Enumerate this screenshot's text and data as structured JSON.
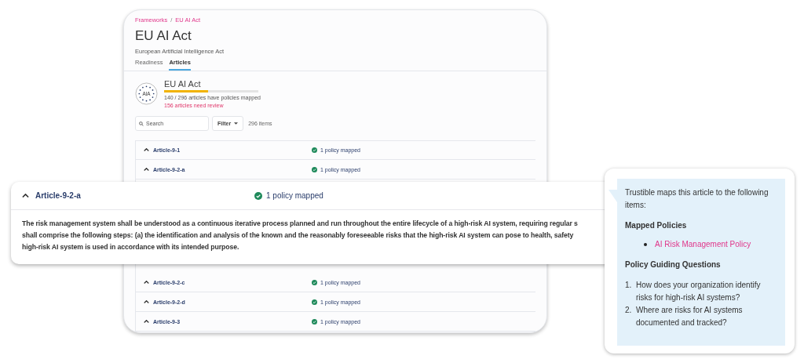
{
  "page": {
    "breadcrumb": [
      "Frameworks",
      "EU AI Act"
    ],
    "breadcrumb_separator": "/",
    "title": "EU AI Act",
    "subtitle": "European Artificial Intelligence Act",
    "tabs": [
      {
        "label": "Readiness",
        "selected": false
      },
      {
        "label": "Articles",
        "selected": true
      }
    ],
    "summary": {
      "logo_text": "AIA",
      "name": "EU AI Act",
      "level": 0.47,
      "mapped": "140 / 296 articles have policies mapped",
      "review": "156 articles need review"
    },
    "search": {
      "placeholder": "Search"
    },
    "filter": {
      "label": "Filter"
    },
    "count": "296 items",
    "rows_top": [
      {
        "name": "Article-9-1",
        "status": "1 policy mapped"
      },
      {
        "name": "Article-9-2-a",
        "status": "1 policy mapped"
      }
    ],
    "rows_bottom": [
      {
        "name": "Article-9-2-c",
        "status": "1 policy mapped"
      },
      {
        "name": "Article-9-2-d",
        "status": "1 policy mapped"
      },
      {
        "name": "Article-9-3",
        "status": "1 policy mapped"
      }
    ]
  },
  "expanded_row": {
    "name": "Article-9-2-a",
    "status": "1 policy mapped",
    "expanded": true,
    "lines": [
      "The risk management system shall be understood as a continuous iterative process planned and run throughout the entire lifecycle of a high-risk AI system, requiring regular s",
      "shall comprise the following steps: (a) the identification and analysis of the known and the reasonably foreseeable risks that the high-risk AI system can pose to health, safety",
      "high-risk AI system is used in accordance with its intended purpose."
    ]
  },
  "callout": {
    "intro": "Trustible maps this article to the following items:",
    "policies_heading": "Mapped Policies",
    "policies": [
      "AI Risk Management Policy"
    ],
    "questions_heading": "Policy Guiding Questions",
    "questions": [
      {
        "number": "1.",
        "text": "How does your organization identify risks for high-risk AI systems?"
      },
      {
        "number": "2.",
        "text": "Where are risks for AI systems documented and tracked?"
      }
    ]
  }
}
